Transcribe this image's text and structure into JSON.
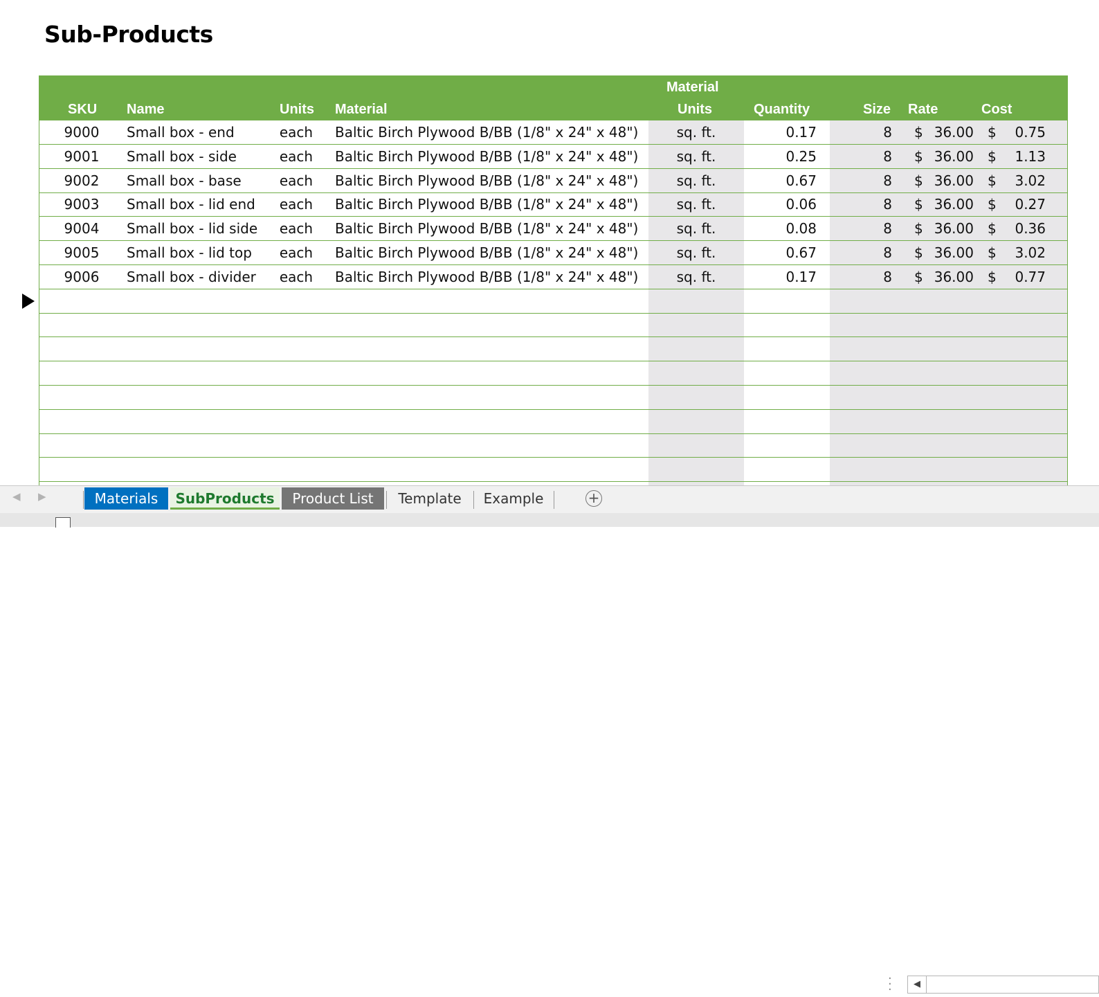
{
  "title": "Sub-Products",
  "headers": {
    "sku": "SKU",
    "name": "Name",
    "units": "Units",
    "material": "Material",
    "material_units_line1": "Material",
    "material_units_line2": "Units",
    "quantity": "Quantity",
    "size": "Size",
    "rate": "Rate",
    "cost": "Cost"
  },
  "rows": [
    {
      "sku": "9000",
      "name": "Small box - end",
      "units": "each",
      "material": "Baltic Birch Plywood B/BB (1/8\" x 24\" x 48\")",
      "material_units": "sq. ft.",
      "quantity": "0.17",
      "size": "8",
      "rate_symbol": "$",
      "rate": "36.00",
      "cost_symbol": "$",
      "cost": "0.75"
    },
    {
      "sku": "9001",
      "name": "Small box - side",
      "units": "each",
      "material": "Baltic Birch Plywood B/BB (1/8\" x 24\" x 48\")",
      "material_units": "sq. ft.",
      "quantity": "0.25",
      "size": "8",
      "rate_symbol": "$",
      "rate": "36.00",
      "cost_symbol": "$",
      "cost": "1.13"
    },
    {
      "sku": "9002",
      "name": "Small box - base",
      "units": "each",
      "material": "Baltic Birch Plywood B/BB (1/8\" x 24\" x 48\")",
      "material_units": "sq. ft.",
      "quantity": "0.67",
      "size": "8",
      "rate_symbol": "$",
      "rate": "36.00",
      "cost_symbol": "$",
      "cost": "3.02"
    },
    {
      "sku": "9003",
      "name": "Small box - lid end",
      "units": "each",
      "material": "Baltic Birch Plywood B/BB (1/8\" x 24\" x 48\")",
      "material_units": "sq. ft.",
      "quantity": "0.06",
      "size": "8",
      "rate_symbol": "$",
      "rate": "36.00",
      "cost_symbol": "$",
      "cost": "0.27"
    },
    {
      "sku": "9004",
      "name": "Small box - lid side",
      "units": "each",
      "material": "Baltic Birch Plywood B/BB (1/8\" x 24\" x 48\")",
      "material_units": "sq. ft.",
      "quantity": "0.08",
      "size": "8",
      "rate_symbol": "$",
      "rate": "36.00",
      "cost_symbol": "$",
      "cost": "0.36"
    },
    {
      "sku": "9005",
      "name": "Small box - lid top",
      "units": "each",
      "material": "Baltic Birch Plywood B/BB (1/8\" x 24\" x 48\")",
      "material_units": "sq. ft.",
      "quantity": "0.67",
      "size": "8",
      "rate_symbol": "$",
      "rate": "36.00",
      "cost_symbol": "$",
      "cost": "3.02"
    },
    {
      "sku": "9006",
      "name": "Small box - divider",
      "units": "each",
      "material": "Baltic Birch Plywood B/BB (1/8\" x 24\" x 48\")",
      "material_units": "sq. ft.",
      "quantity": "0.17",
      "size": "8",
      "rate_symbol": "$",
      "rate": "36.00",
      "cost_symbol": "$",
      "cost": "0.77"
    }
  ],
  "sheet_tabs": [
    {
      "label": "Materials",
      "style": "blue"
    },
    {
      "label": "SubProducts",
      "style": "active"
    },
    {
      "label": "Product List",
      "style": "gray"
    },
    {
      "label": "Template",
      "style": "plain"
    },
    {
      "label": "Example",
      "style": "plain"
    }
  ],
  "icons": {
    "row_marker": "triangle-right-icon",
    "add_sheet": "plus-circle-icon",
    "nav_prev": "chevron-left-icon",
    "nav_next": "chevron-right-icon",
    "scroll_left": "chevron-left-icon"
  },
  "colors": {
    "header_green": "#70ad47",
    "shade_gray": "#e8e7e9",
    "tab_blue": "#0070c0",
    "tab_gray": "#757575",
    "active_tab_text": "#1e7a2e"
  }
}
